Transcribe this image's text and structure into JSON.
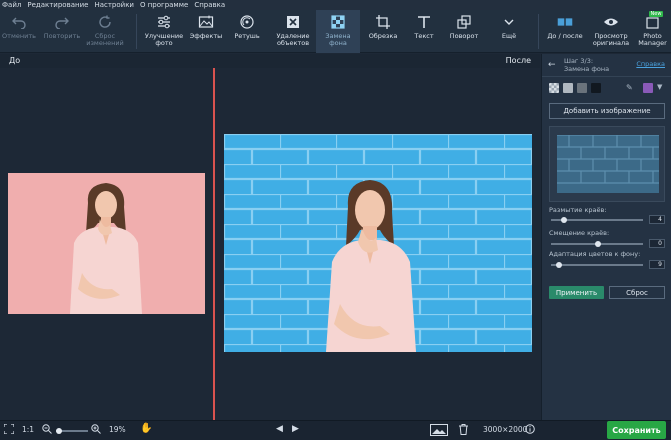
{
  "menu": [
    "Файл",
    "Редактирование",
    "Настройки",
    "О программе",
    "Справка"
  ],
  "toolbar": {
    "undo": "Отменить",
    "redo": "Повторить",
    "reset": "Сброс\nизменений",
    "enhance": "Улучшение\nфото",
    "effects": "Эффекты",
    "retouch": "Ретушь",
    "remove_objects": "Удаление\nобъектов",
    "replace_bg": "Замена\nфона",
    "crop": "Обрезка",
    "text": "Текст",
    "rotate": "Поворот",
    "more": "Ещё",
    "before_after": "До / после",
    "view_original": "Просмотр\nоригинала",
    "photo_manager": "Photo\nManager",
    "new_badge": "New"
  },
  "labels": {
    "before": "До",
    "after": "После"
  },
  "panel": {
    "step": "Шаг 3/3:",
    "step_title": "Замена фона",
    "help": "Справка",
    "add_image": "Добавить изображение",
    "sliders": [
      {
        "label": "Размытие краёв:",
        "value": "4"
      },
      {
        "label": "Смещение краёв:",
        "value": "0"
      },
      {
        "label": "Адаптация цветов к фону:",
        "value": "9"
      }
    ],
    "apply": "Применить",
    "reset": "Сброс"
  },
  "bottom": {
    "ratio": "1:1",
    "zoom": "19%",
    "dimensions": "3000×2000",
    "save": "Сохранить"
  },
  "colors": {
    "accent_green": "#28a745",
    "divider_red": "#d9534f",
    "swatch_purple": "#8a5ab8",
    "after_bg_blue": "#3da8e0",
    "before_bg_pink": "#f0aeae"
  }
}
